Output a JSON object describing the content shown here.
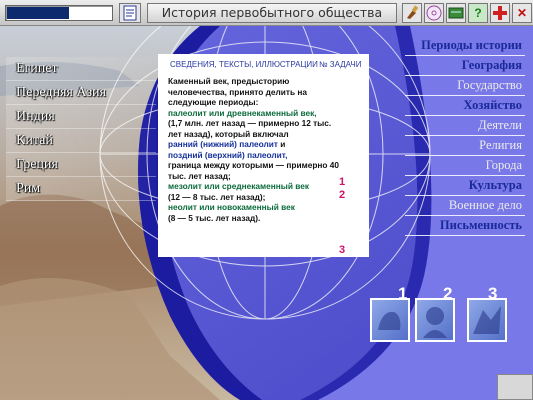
{
  "app": {
    "title": "История первобытного общества",
    "progress": 0.6
  },
  "toolbar": {
    "icons": [
      "document-icon",
      "brush-icon",
      "disc-icon",
      "card-icon",
      "help-icon",
      "plus-icon",
      "close-icon"
    ],
    "help_label": "?",
    "close_label": "✕"
  },
  "left_nav": {
    "items": [
      {
        "label": "Египет"
      },
      {
        "label": "Передняя Азия"
      },
      {
        "label": "Индия"
      },
      {
        "label": "Китай"
      },
      {
        "label": "Греция"
      },
      {
        "label": "Рим"
      }
    ]
  },
  "panel": {
    "header_left": "СВЕДЕНИЯ, ТЕКСТЫ, ИЛЛЮСТРАЦИИ",
    "header_right": "№ ЗАДАЧИ",
    "t1": "Каменный век, предысторию человечества, принято делить на следующие периоды:",
    "t2": "палеолит или древнекаменный век,",
    "t3": "(1,7 млн. лет назад — примерно 12 тыс. лет назад), который включал",
    "t4": "ранний (нижний) палеолит",
    "t4b": " и",
    "t5": "поздний (верхний) палеолит,",
    "t6": "граница между которыми — примерно 40 тыс. лет назад;",
    "t7": "мезолит или среднекаменный век",
    "t8": "(12 — 8 тыс. лет назад);",
    "t9": "неолит или новокаменный век",
    "t10": "(8 — 5 тыс. лет назад).",
    "task_numbers": [
      "1",
      "2",
      "3"
    ]
  },
  "right_nav": {
    "items": [
      {
        "label": "Периоды истории"
      },
      {
        "label": "География"
      },
      {
        "label": "Государство"
      },
      {
        "label": "Хозяйство"
      },
      {
        "label": "Деятели"
      },
      {
        "label": "Религия"
      },
      {
        "label": "Города"
      },
      {
        "label": "Культура"
      },
      {
        "label": "Военное дело"
      },
      {
        "label": "Письменность"
      }
    ]
  },
  "thumbnails": {
    "numbers": [
      "1",
      "2",
      "3"
    ]
  },
  "colors": {
    "accent_blue": "#1a2a9a",
    "task_number": "#d1136b",
    "term_green": "#0a6a3a",
    "background_blue": "#5c5cd6"
  }
}
